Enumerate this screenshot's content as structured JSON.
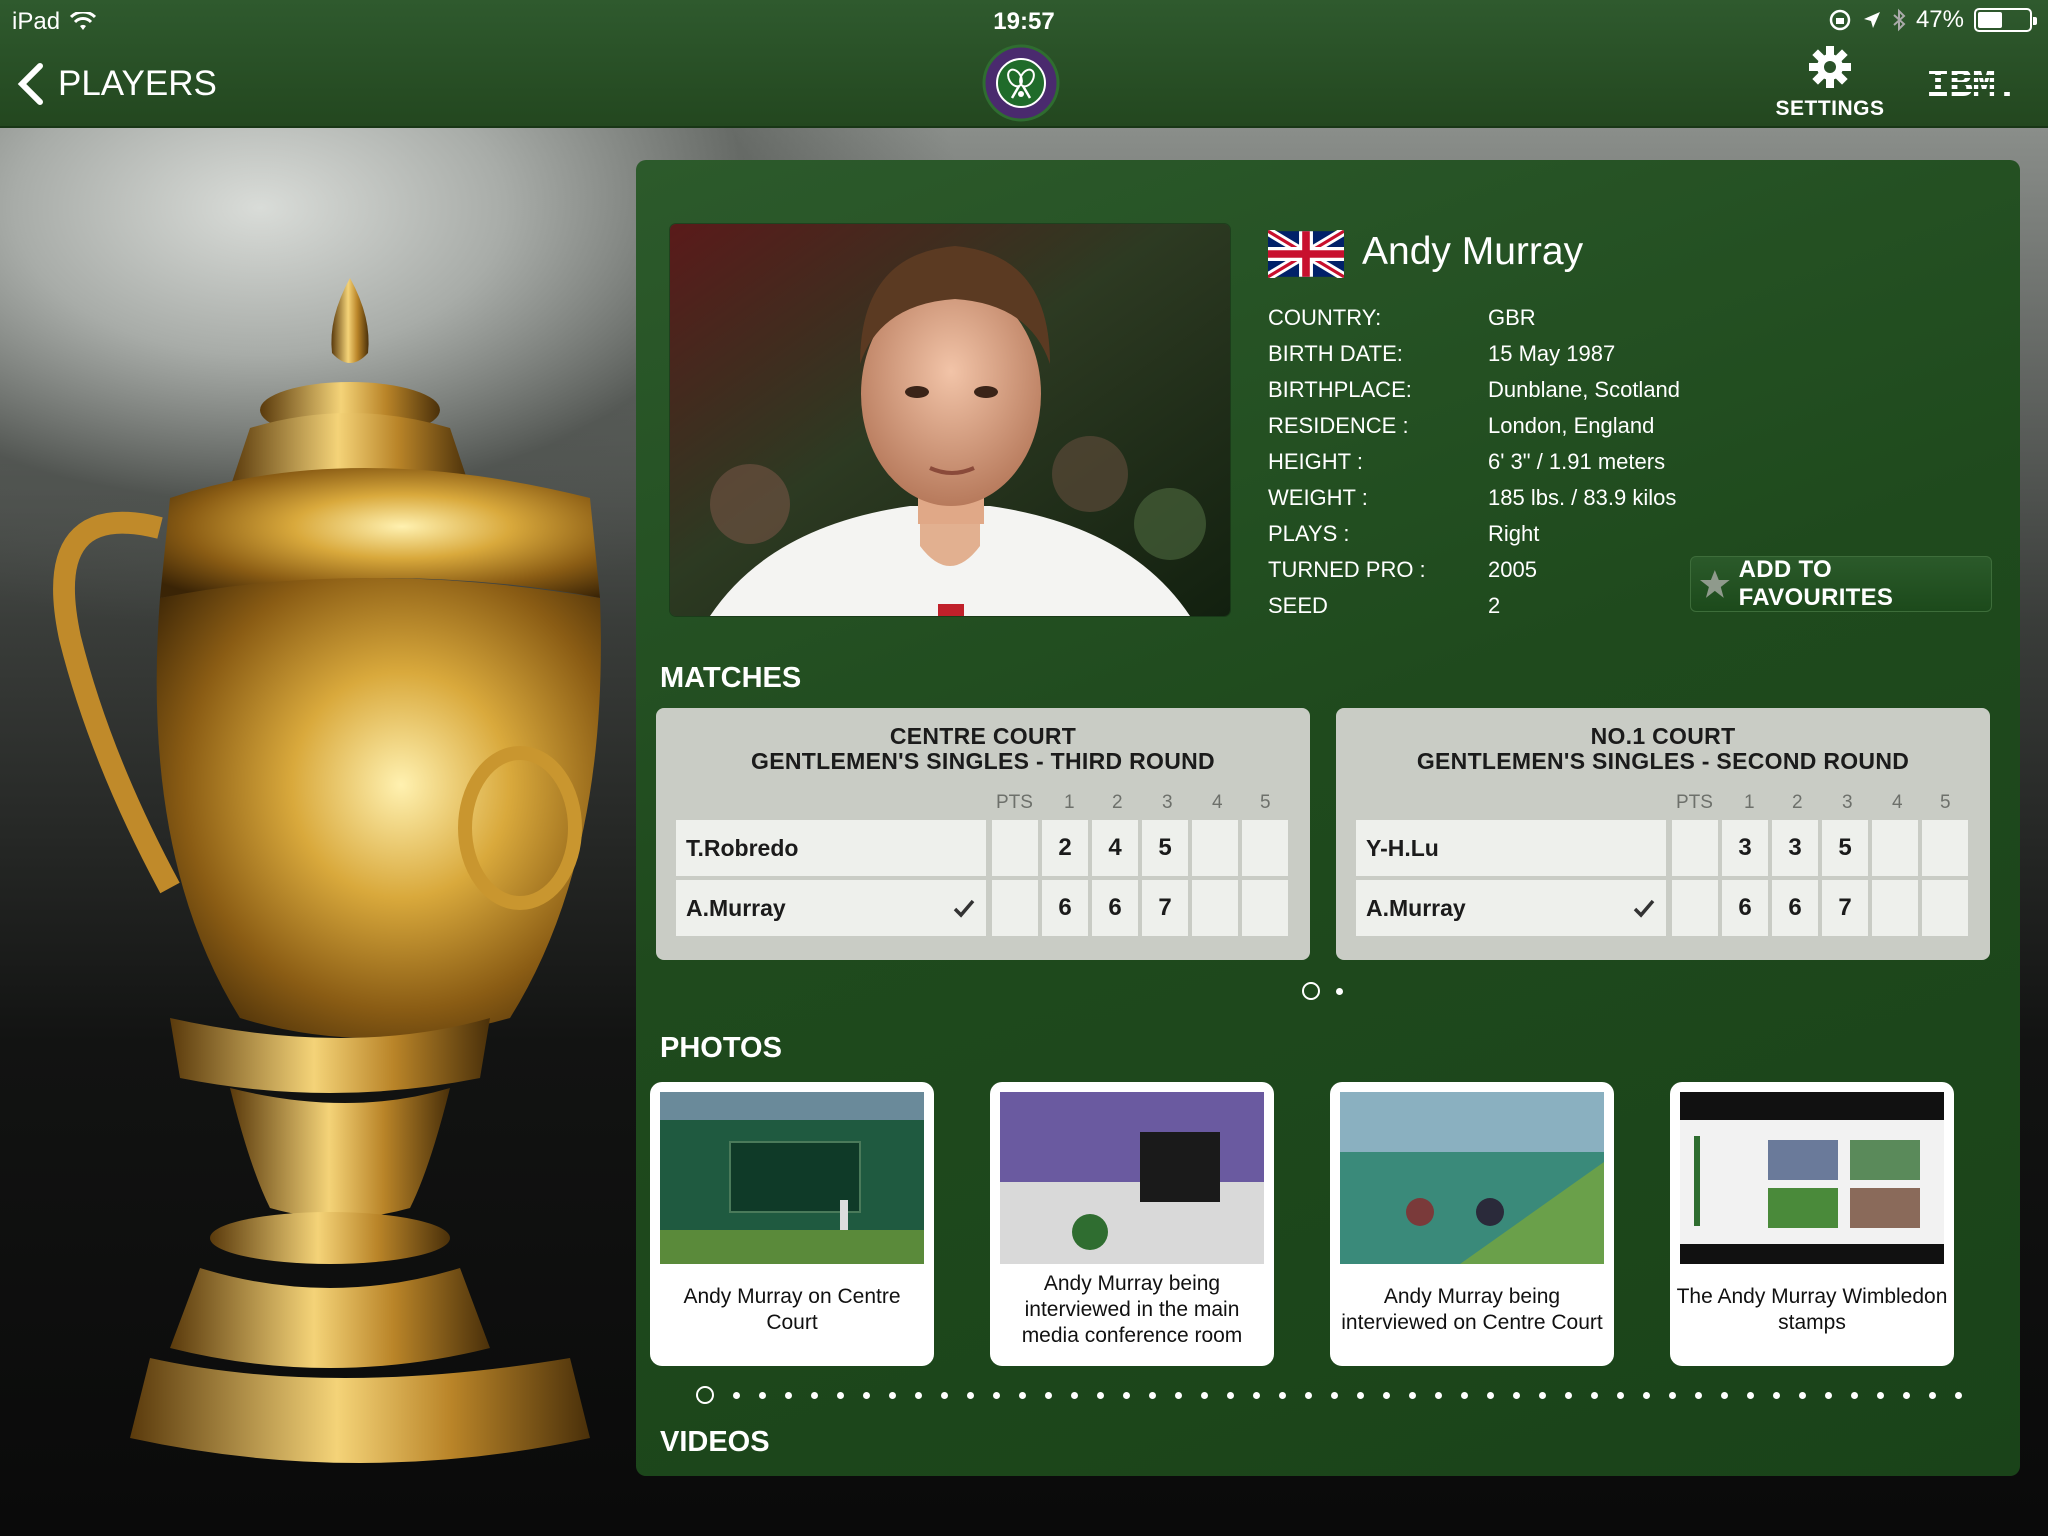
{
  "status_bar": {
    "carrier": "iPad",
    "time": "19:57",
    "battery_text": "47%",
    "battery_level": 0.47
  },
  "nav": {
    "back_label": "PLAYERS",
    "settings_label": "SETTINGS",
    "brand": "IBM."
  },
  "player": {
    "name": "Andy Murray",
    "flag": "uk-flag",
    "details": [
      {
        "label": "COUNTRY:",
        "value": "GBR"
      },
      {
        "label": "BIRTH DATE:",
        "value": "15 May 1987"
      },
      {
        "label": "BIRTHPLACE:",
        "value": "Dunblane, Scotland"
      },
      {
        "label": "RESIDENCE :",
        "value": "London, England"
      },
      {
        "label": "HEIGHT :",
        "value": "6' 3\" / 1.91 meters"
      },
      {
        "label": "WEIGHT :",
        "value": "185 lbs. / 83.9 kilos"
      },
      {
        "label": "PLAYS :",
        "value": "Right"
      },
      {
        "label": "TURNED PRO :",
        "value": "2005"
      },
      {
        "label": "SEED",
        "value": "2"
      }
    ],
    "favourite_label": "ADD TO FAVOURITES"
  },
  "matches": {
    "title": "MATCHES",
    "headers": [
      "PTS",
      "1",
      "2",
      "3",
      "4",
      "5"
    ],
    "cards": [
      {
        "court": "CENTRE COURT",
        "round": "GENTLEMEN'S SINGLES - THIRD ROUND",
        "players": [
          {
            "name": "T.Robredo",
            "winner": false,
            "pts": "",
            "sets": [
              "2",
              "4",
              "5",
              "",
              ""
            ]
          },
          {
            "name": "A.Murray",
            "winner": true,
            "pts": "",
            "sets": [
              "6",
              "6",
              "7",
              "",
              ""
            ]
          }
        ]
      },
      {
        "court": "NO.1 COURT",
        "round": "GENTLEMEN'S SINGLES - SECOND ROUND",
        "players": [
          {
            "name": "Y-H.Lu",
            "winner": false,
            "pts": "",
            "sets": [
              "3",
              "3",
              "5",
              "",
              ""
            ]
          },
          {
            "name": "A.Murray",
            "winner": true,
            "pts": "",
            "sets": [
              "6",
              "6",
              "7",
              "",
              ""
            ]
          }
        ]
      }
    ],
    "page_count": 2,
    "page_index": 0
  },
  "photos": {
    "title": "PHOTOS",
    "items": [
      {
        "caption": "Andy Murray on Centre Court"
      },
      {
        "caption": "Andy Murray being interviewed in the main media conference room"
      },
      {
        "caption": "Andy Murray being interviewed on Centre Court"
      },
      {
        "caption": "The Andy Murray Wimbledon stamps"
      }
    ],
    "page_count": 49,
    "page_index": 0
  },
  "videos": {
    "title": "VIDEOS"
  },
  "colors": {
    "nav_green": "#2f5a2e",
    "panel_green": "#1f4a1d",
    "card_grey": "#c9ccc5",
    "wimbledon_purple": "#4a2a6e"
  },
  "icons": {
    "back": "chevron-left-icon",
    "settings": "gear-icon",
    "favourite": "star-icon",
    "winner": "checkmark-icon"
  }
}
